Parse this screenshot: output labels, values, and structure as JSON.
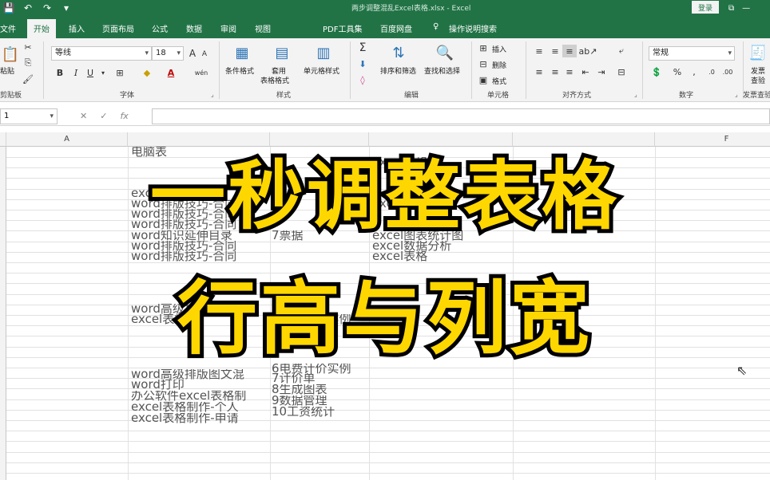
{
  "window": {
    "title": "两步调整混乱Excel表格.xlsx - Excel",
    "login": "登录"
  },
  "quick_access": [
    "save-icon",
    "undo-icon",
    "redo-icon",
    "customize-icon"
  ],
  "tabs": [
    "文件",
    "开始",
    "插入",
    "页面布局",
    "公式",
    "数据",
    "审阅",
    "视图",
    "PDF工具集",
    "百度网盘",
    "操作说明搜索"
  ],
  "active_tab": "开始",
  "ribbon": {
    "clipboard": {
      "label": "剪贴板",
      "paste": "粘贴"
    },
    "font": {
      "label": "字体",
      "name": "等线",
      "size": "18",
      "bold": "B",
      "italic": "I",
      "underline": "U",
      "grow": "A",
      "shrink": "A",
      "wen": "wén"
    },
    "styles": {
      "label": "样式",
      "conditional": "条件格式",
      "table": [
        "套用",
        "表格格式"
      ],
      "cell_styles": "单元格样式"
    },
    "editing": {
      "label": "编辑",
      "sort": "排序和筛选",
      "find": "查找和选择"
    },
    "cells": {
      "label": "单元格",
      "insert": "插入",
      "delete": "删除",
      "format": "格式"
    },
    "alignment": {
      "label": "对齐方式"
    },
    "number": {
      "label": "数字",
      "format": "常规",
      "percent": "%"
    },
    "send": {
      "label": "发票查验",
      "btn": [
        "发票",
        "查验"
      ]
    }
  },
  "formula_bar": {
    "name_box": "1",
    "fx": "fx"
  },
  "columns": [
    "A",
    "F"
  ],
  "cells": [
    "电脑表",
    "excel表格",
    "word知识延伸目录",
    "word排版技巧-合同",
    "word高级排版图文混",
    "word打印",
    "办公软件excel表格制",
    "excel表格制作-个人",
    "excel表格制作-申请",
    "7票据",
    "7计价单",
    "8生成图表",
    "9数据管理",
    "10工资统计",
    "6电费计价实例",
    "excel图表统计图",
    "excel数据分析"
  ],
  "overlay": {
    "line1": "一秒调整表格",
    "line2": "行高与列宽"
  }
}
